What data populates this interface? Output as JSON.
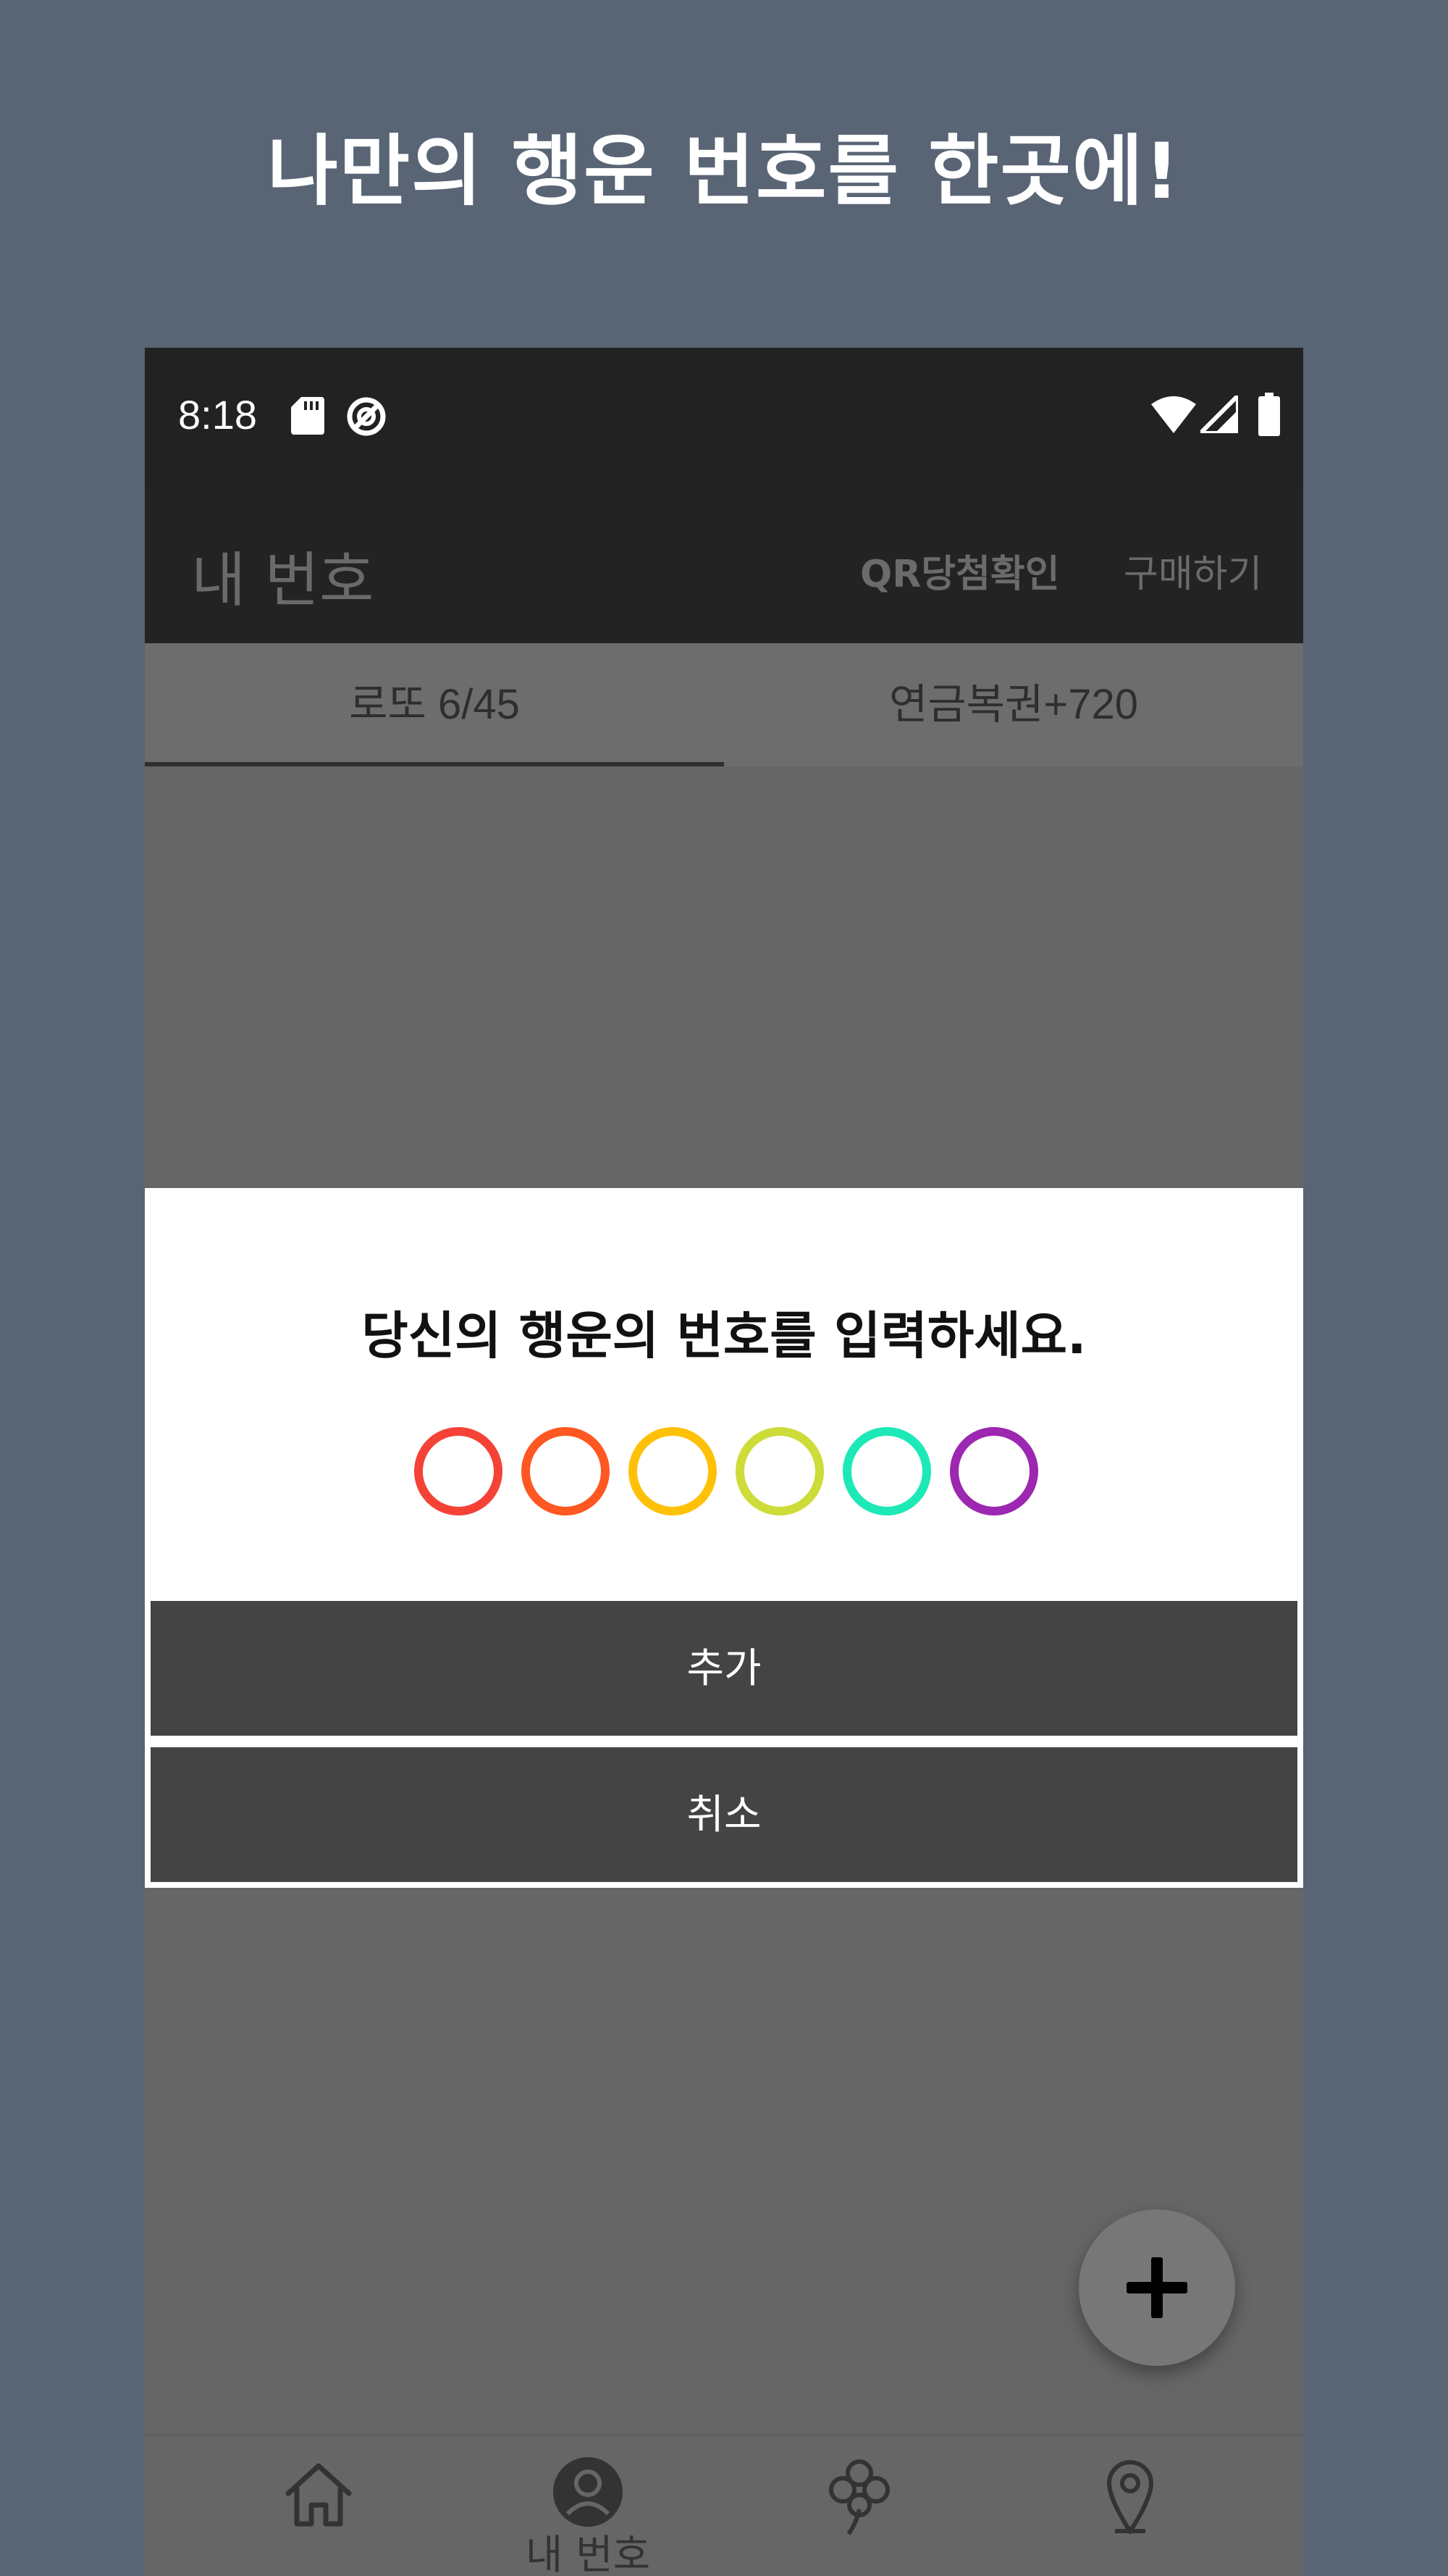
{
  "promo": {
    "headline": "나만의 행운 번호를 한곳에!"
  },
  "status_bar": {
    "time": "8:18",
    "icons": [
      "sd-card-icon",
      "data-saver-icon",
      "wifi-icon",
      "signal-icon",
      "battery-icon"
    ]
  },
  "app_bar": {
    "title": "내 번호",
    "actions": {
      "qr": "QR당첨확인",
      "buy": "구매하기"
    }
  },
  "tabs": [
    {
      "label": "로또 6/45",
      "selected": true
    },
    {
      "label": "연금복권+720",
      "selected": false
    }
  ],
  "dialog": {
    "title": "당신의 행운의 번호를 입력하세요.",
    "ball_colors": [
      "#f44336",
      "#ff5722",
      "#ffc107",
      "#cddc39",
      "#1de9b6",
      "#9c27b0"
    ],
    "add_label": "추가",
    "cancel_label": "취소"
  },
  "fab": {
    "icon": "plus-icon"
  },
  "bottom_nav": {
    "items": [
      {
        "icon": "home-icon",
        "label": ""
      },
      {
        "icon": "person-icon",
        "label": "내 번호",
        "selected": true
      },
      {
        "icon": "clover-icon",
        "label": ""
      },
      {
        "icon": "location-pin-icon",
        "label": ""
      }
    ]
  }
}
